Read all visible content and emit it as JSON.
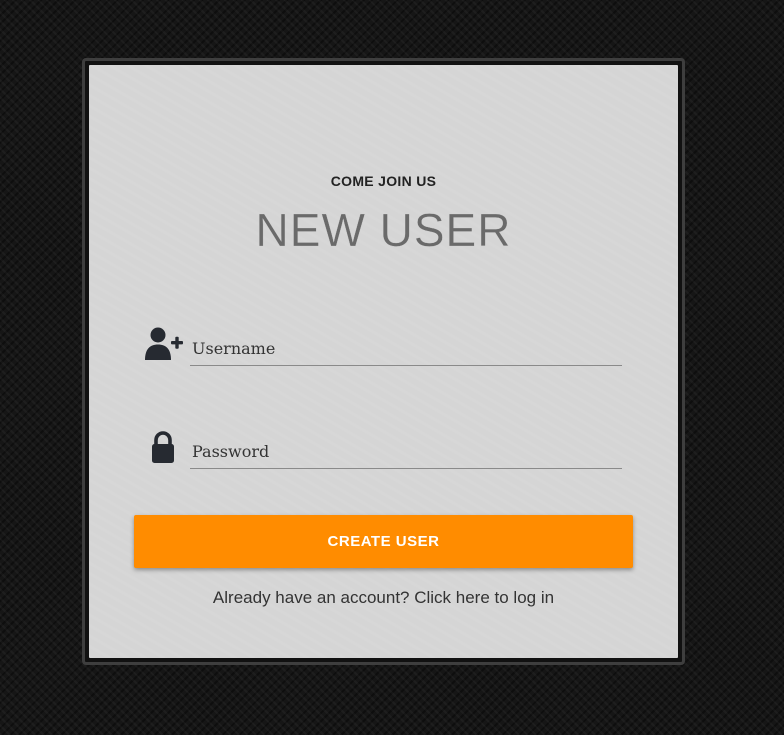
{
  "header": {
    "subtitle": "COME JOIN US",
    "title": "NEW USER"
  },
  "form": {
    "username": {
      "placeholder": "Username",
      "value": "",
      "icon": "user-plus-icon"
    },
    "password": {
      "placeholder": "Password",
      "value": "",
      "icon": "lock-icon"
    },
    "submit_label": "CREATE USER",
    "login_link": "Already have an account? Click here to log in"
  },
  "colors": {
    "accent": "#ff8c00",
    "card": "#d5d5d5",
    "background": "#161616"
  }
}
